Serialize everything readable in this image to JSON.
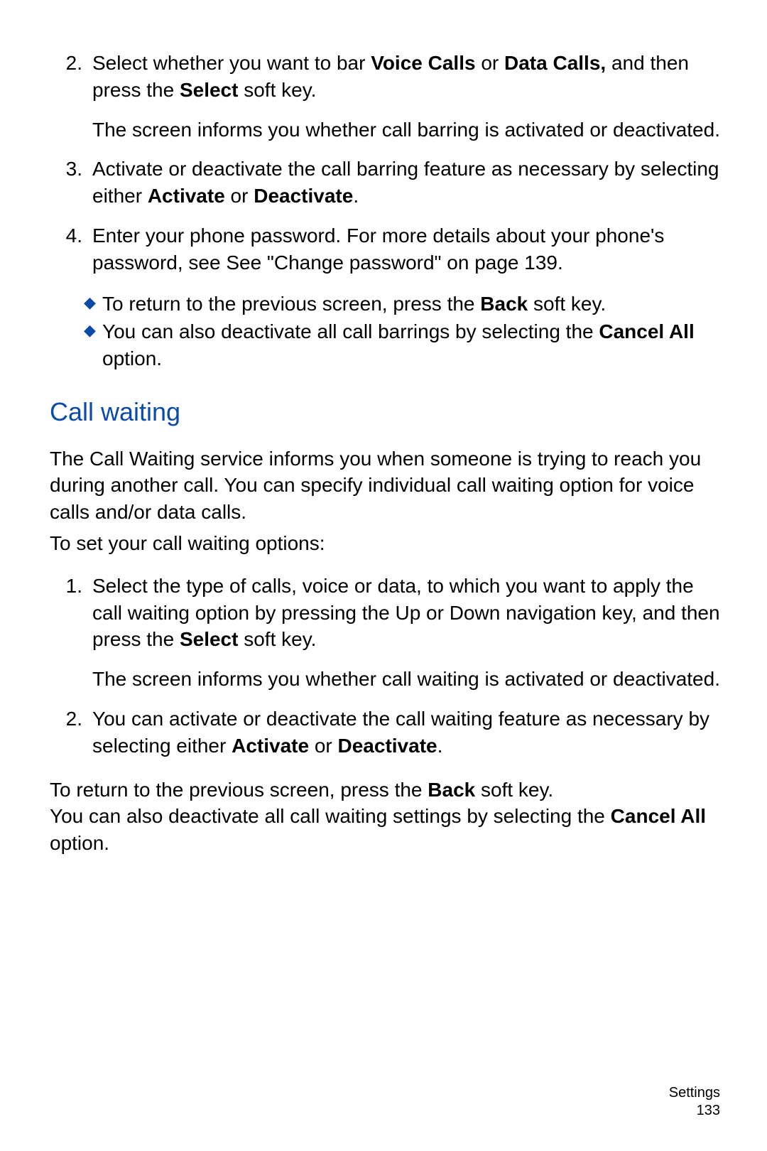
{
  "top_steps": [
    {
      "num": "2.",
      "runs": [
        {
          "t": "Select whether you want to bar "
        },
        {
          "t": "Voice Calls",
          "b": true
        },
        {
          "t": " or "
        },
        {
          "t": "Data Calls,",
          "b": true
        },
        {
          "t": " and then press the "
        },
        {
          "t": "Select",
          "b": true
        },
        {
          "t": " soft key."
        }
      ],
      "sub": [
        {
          "t": "The screen informs you whether call barring is activated or deactivated."
        }
      ]
    },
    {
      "num": "3.",
      "runs": [
        {
          "t": "Activate or deactivate the call barring feature as necessary by selecting either "
        },
        {
          "t": "Activate",
          "b": true
        },
        {
          "t": " or "
        },
        {
          "t": "Deactivate",
          "b": true
        },
        {
          "t": "."
        }
      ]
    },
    {
      "num": "4.",
      "runs": [
        {
          "t": "Enter your phone password. For more details about your phone's password, see See \"Change password\" on page 139."
        }
      ]
    }
  ],
  "top_bullets": [
    {
      "runs": [
        {
          "t": "To return to the previous screen, press the "
        },
        {
          "t": "Back",
          "b": true
        },
        {
          "t": " soft key."
        }
      ]
    },
    {
      "runs": [
        {
          "t": "You can also deactivate all call barrings by selecting the "
        },
        {
          "t": "Cancel All",
          "b": true
        },
        {
          "t": " option."
        }
      ]
    }
  ],
  "section_heading": "Call waiting",
  "intro_para": "The Call Waiting service informs you when someone is trying to reach you during another call. You can specify individual call waiting option for voice calls and/or data calls.",
  "intro_para2": "To set your call waiting options:",
  "section_steps": [
    {
      "num": "1.",
      "runs": [
        {
          "t": "Select the type of calls, voice or data, to which you want to apply the call waiting option by pressing the Up or Down navigation key, and then press the "
        },
        {
          "t": "Select",
          "b": true
        },
        {
          "t": " soft key."
        }
      ],
      "sub": [
        {
          "t": "The screen informs you whether call waiting is activated or deactivated."
        }
      ]
    },
    {
      "num": "2.",
      "runs": [
        {
          "t": "You can activate or deactivate the call waiting feature as necessary by selecting either "
        },
        {
          "t": "Activate",
          "b": true
        },
        {
          "t": " or "
        },
        {
          "t": "Deactivate",
          "b": true
        },
        {
          "t": "."
        }
      ]
    }
  ],
  "closing_runs_a": [
    {
      "t": "To return to the previous screen, press the "
    },
    {
      "t": "Back",
      "b": true
    },
    {
      "t": " soft key."
    }
  ],
  "closing_runs_b": [
    {
      "t": "You can also deactivate all call waiting settings by selecting the "
    },
    {
      "t": "Cancel All",
      "b": true
    },
    {
      "t": " option."
    }
  ],
  "footer_section": "Settings",
  "footer_page": "133"
}
